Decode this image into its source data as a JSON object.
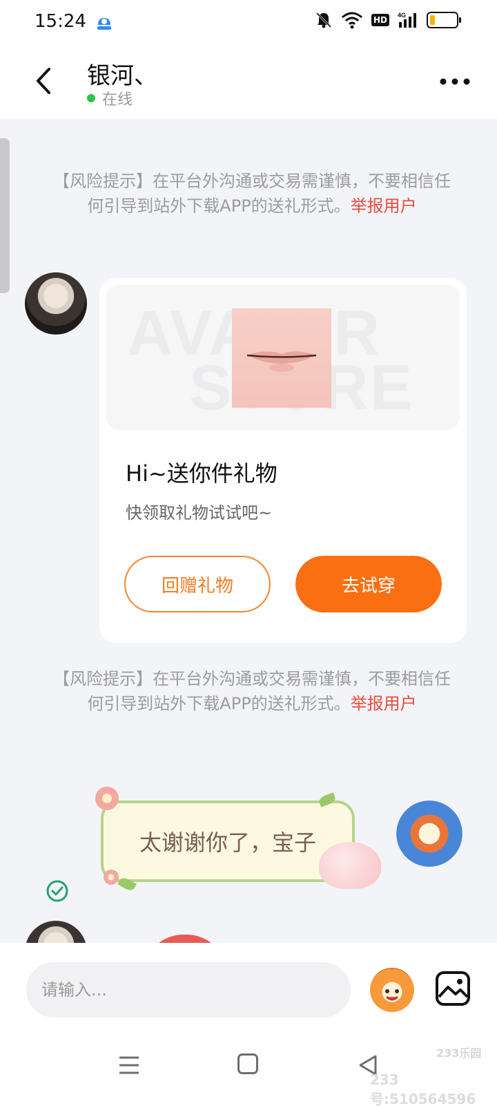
{
  "status_bar": {
    "time": "15:24",
    "app_icon": "cloud-app-icon",
    "icons": [
      "mute-bell-icon",
      "wifi-icon",
      "hd-badge",
      "cellular-4g-icon",
      "battery-icon"
    ],
    "hd_label": "HD",
    "network_label": "4G",
    "battery_level": 0.2,
    "battery_color": "#f5b400"
  },
  "header": {
    "contact_name": "银河、",
    "status": "在线",
    "status_color": "#2bc64a",
    "back_icon": "chevron-left-icon",
    "more_icon": "more-dots-icon"
  },
  "messages": {
    "risk_notice_1": {
      "text": "【风险提示】在平台外沟通或交易需谨慎，不要相信任何引导到站外下载APP的送礼形式。",
      "report_link": "举报用户"
    },
    "gift_card": {
      "banner_watermark_line1": "AVATAR",
      "banner_watermark_line2": "STORE",
      "title": "Hi~送你件礼物",
      "subtitle": "快领取礼物试试吧~",
      "return_button": "回赠礼物",
      "try_button": "去试穿"
    },
    "risk_notice_2": {
      "text": "【风险提示】在平台外沟通或交易需谨慎，不要相信任何引导到站外下载APP的送礼形式。",
      "report_link": "举报用户"
    },
    "sent_message": {
      "text": "太谢谢你了，宝子",
      "read_icon": "check-circle-icon"
    }
  },
  "input": {
    "placeholder": "请输入...",
    "emoji_icon": "emoji-mascot-icon",
    "image_icon": "image-icon"
  },
  "nav": {
    "menu_icon": "menu-icon",
    "home_icon": "home-square-icon",
    "back_icon": "back-triangle-icon"
  },
  "watermark": {
    "logo": "233乐园",
    "id": "233号:510564596"
  },
  "colors": {
    "accent": "#fb6f13",
    "report": "#e94b3c",
    "background": "#f3f4f8"
  }
}
